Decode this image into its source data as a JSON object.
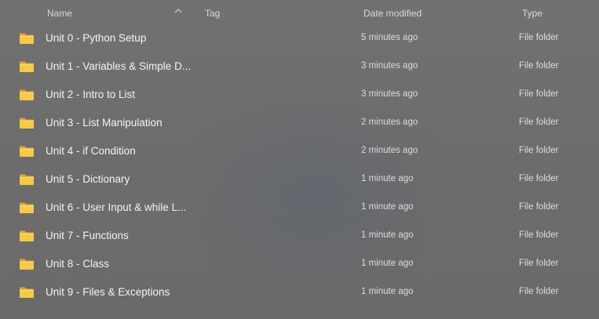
{
  "columns": {
    "name": "Name",
    "tag": "Tag",
    "date_modified": "Date modified",
    "type": "Type",
    "sort_icon": "chevron-up-icon"
  },
  "folder_icon": "folder-icon",
  "colors": {
    "folder": "#f5c54a",
    "folder_dark": "#e0a82c"
  },
  "rows": [
    {
      "name": "Unit 0 - Python Setup",
      "date": "5 minutes ago",
      "type": "File folder"
    },
    {
      "name": "Unit 1 - Variables & Simple D...",
      "date": "3 minutes ago",
      "type": "File folder"
    },
    {
      "name": "Unit 2 - Intro to List",
      "date": "3 minutes ago",
      "type": "File folder"
    },
    {
      "name": "Unit 3 - List Manipulation",
      "date": "2 minutes ago",
      "type": "File folder"
    },
    {
      "name": "Unit 4 - if Condition",
      "date": "2 minutes ago",
      "type": "File folder"
    },
    {
      "name": "Unit 5 - Dictionary",
      "date": "1 minute ago",
      "type": "File folder"
    },
    {
      "name": "Unit 6 - User Input & while L...",
      "date": "1 minute ago",
      "type": "File folder"
    },
    {
      "name": "Unit 7 - Functions",
      "date": "1 minute ago",
      "type": "File folder"
    },
    {
      "name": "Unit 8 - Class",
      "date": "1 minute ago",
      "type": "File folder"
    },
    {
      "name": "Unit 9 - Files & Exceptions",
      "date": "1 minute ago",
      "type": "File folder"
    }
  ]
}
